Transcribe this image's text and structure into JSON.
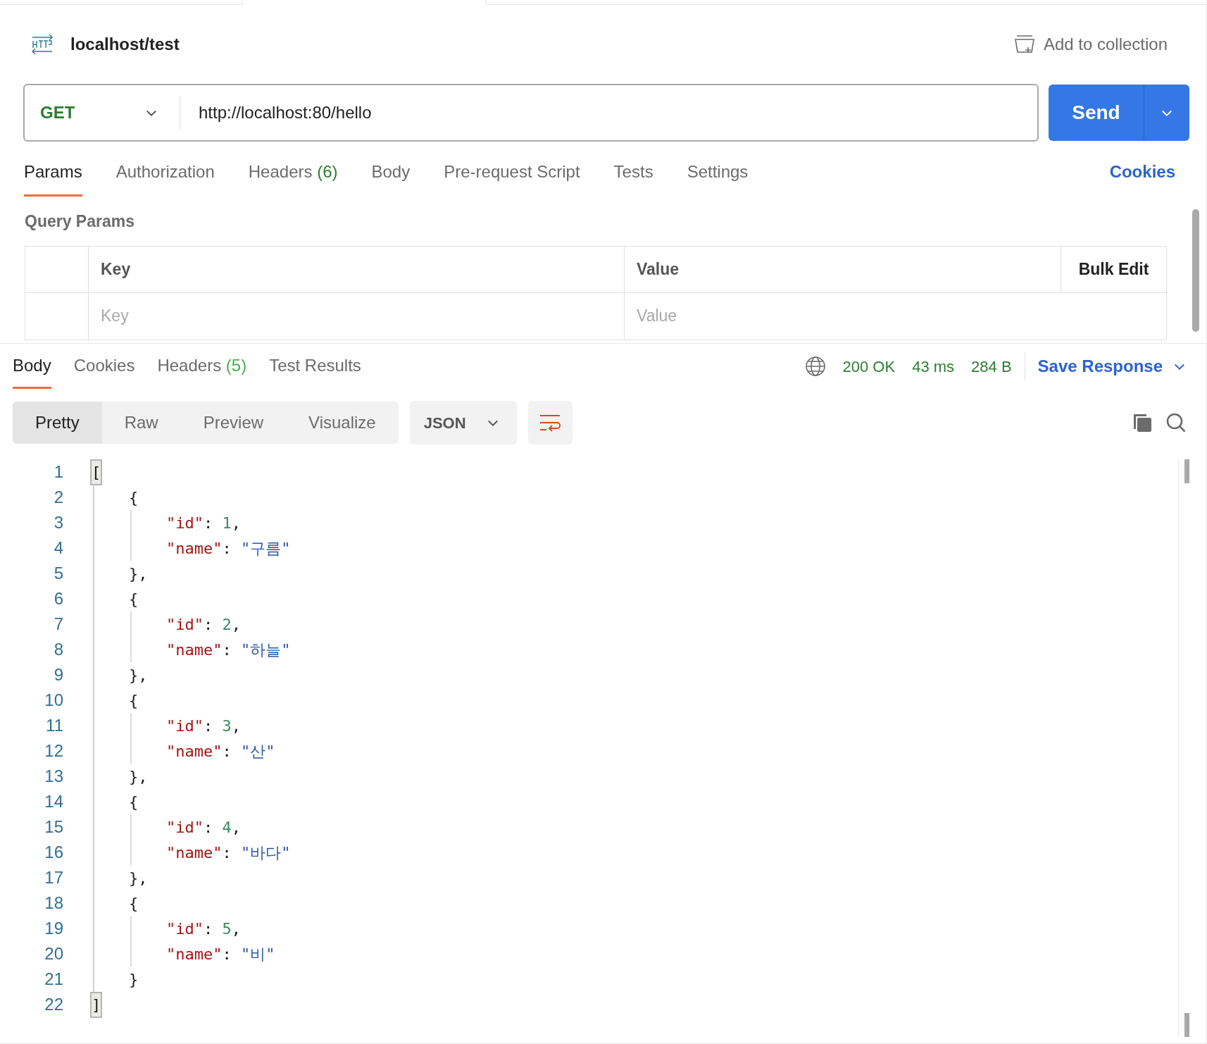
{
  "request": {
    "title": "localhost/test",
    "add_to_collection": "Add to collection",
    "method": "GET",
    "url": "http://localhost:80/hello",
    "send": "Send"
  },
  "request_tabs": [
    {
      "label": "Params",
      "selected": true
    },
    {
      "label": "Authorization",
      "selected": false
    },
    {
      "label": "Headers",
      "count": "(6)",
      "selected": false
    },
    {
      "label": "Body",
      "selected": false
    },
    {
      "label": "Pre-request Script",
      "selected": false
    },
    {
      "label": "Tests",
      "selected": false
    },
    {
      "label": "Settings",
      "selected": false
    }
  ],
  "cookies_link": "Cookies",
  "query_params": {
    "title": "Query Params",
    "columns": [
      "Key",
      "Value"
    ],
    "bulk_edit": "Bulk Edit",
    "row": {
      "key_placeholder": "Key",
      "value_placeholder": "Value"
    }
  },
  "response_tabs": [
    {
      "label": "Body",
      "selected": true
    },
    {
      "label": "Cookies",
      "selected": false
    },
    {
      "label": "Headers",
      "count": "(5)",
      "selected": false
    },
    {
      "label": "Test Results",
      "selected": false
    }
  ],
  "status": {
    "code": "200 OK",
    "time": "43 ms",
    "size": "284 B",
    "save": "Save Response"
  },
  "view_modes": [
    {
      "label": "Pretty",
      "selected": true
    },
    {
      "label": "Raw",
      "selected": false
    },
    {
      "label": "Preview",
      "selected": false
    },
    {
      "label": "Visualize",
      "selected": false
    }
  ],
  "format": "JSON",
  "code_lines": [
    {
      "number": "1",
      "highlighted": true,
      "tokens": [
        {
          "kind": "punct",
          "text": "["
        }
      ]
    },
    {
      "number": "2",
      "highlighted": false,
      "tokens": [
        {
          "kind": "punct",
          "text": "    {"
        }
      ]
    },
    {
      "number": "3",
      "highlighted": false,
      "tokens": [
        {
          "kind": "key",
          "text": "        \"id\""
        },
        {
          "kind": "punct",
          "text": ": "
        },
        {
          "kind": "number",
          "text": "1"
        },
        {
          "kind": "punct",
          "text": ","
        }
      ]
    },
    {
      "number": "4",
      "highlighted": false,
      "tokens": [
        {
          "kind": "key",
          "text": "        \"name\""
        },
        {
          "kind": "punct",
          "text": ": "
        },
        {
          "kind": "string",
          "text": "\"구름\""
        }
      ]
    },
    {
      "number": "5",
      "highlighted": false,
      "tokens": [
        {
          "kind": "punct",
          "text": "    },"
        }
      ]
    },
    {
      "number": "6",
      "highlighted": false,
      "tokens": [
        {
          "kind": "punct",
          "text": "    {"
        }
      ]
    },
    {
      "number": "7",
      "highlighted": false,
      "tokens": [
        {
          "kind": "key",
          "text": "        \"id\""
        },
        {
          "kind": "punct",
          "text": ": "
        },
        {
          "kind": "number",
          "text": "2"
        },
        {
          "kind": "punct",
          "text": ","
        }
      ]
    },
    {
      "number": "8",
      "highlighted": false,
      "tokens": [
        {
          "kind": "key",
          "text": "        \"name\""
        },
        {
          "kind": "punct",
          "text": ": "
        },
        {
          "kind": "string",
          "text": "\"하늘\""
        }
      ]
    },
    {
      "number": "9",
      "highlighted": false,
      "tokens": [
        {
          "kind": "punct",
          "text": "    },"
        }
      ]
    },
    {
      "number": "10",
      "highlighted": false,
      "tokens": [
        {
          "kind": "punct",
          "text": "    {"
        }
      ]
    },
    {
      "number": "11",
      "highlighted": false,
      "tokens": [
        {
          "kind": "key",
          "text": "        \"id\""
        },
        {
          "kind": "punct",
          "text": ": "
        },
        {
          "kind": "number",
          "text": "3"
        },
        {
          "kind": "punct",
          "text": ","
        }
      ]
    },
    {
      "number": "12",
      "highlighted": false,
      "tokens": [
        {
          "kind": "key",
          "text": "        \"name\""
        },
        {
          "kind": "punct",
          "text": ": "
        },
        {
          "kind": "string",
          "text": "\"산\""
        }
      ]
    },
    {
      "number": "13",
      "highlighted": false,
      "tokens": [
        {
          "kind": "punct",
          "text": "    },"
        }
      ]
    },
    {
      "number": "14",
      "highlighted": false,
      "tokens": [
        {
          "kind": "punct",
          "text": "    {"
        }
      ]
    },
    {
      "number": "15",
      "highlighted": false,
      "tokens": [
        {
          "kind": "key",
          "text": "        \"id\""
        },
        {
          "kind": "punct",
          "text": ": "
        },
        {
          "kind": "number",
          "text": "4"
        },
        {
          "kind": "punct",
          "text": ","
        }
      ]
    },
    {
      "number": "16",
      "highlighted": false,
      "tokens": [
        {
          "kind": "key",
          "text": "        \"name\""
        },
        {
          "kind": "punct",
          "text": ": "
        },
        {
          "kind": "string",
          "text": "\"바다\""
        }
      ]
    },
    {
      "number": "17",
      "highlighted": false,
      "tokens": [
        {
          "kind": "punct",
          "text": "    },"
        }
      ]
    },
    {
      "number": "18",
      "highlighted": false,
      "tokens": [
        {
          "kind": "punct",
          "text": "    {"
        }
      ]
    },
    {
      "number": "19",
      "highlighted": false,
      "tokens": [
        {
          "kind": "key",
          "text": "        \"id\""
        },
        {
          "kind": "punct",
          "text": ": "
        },
        {
          "kind": "number",
          "text": "5"
        },
        {
          "kind": "punct",
          "text": ","
        }
      ]
    },
    {
      "number": "20",
      "highlighted": false,
      "tokens": [
        {
          "kind": "key",
          "text": "        \"name\""
        },
        {
          "kind": "punct",
          "text": ": "
        },
        {
          "kind": "string",
          "text": "\"비\""
        }
      ]
    },
    {
      "number": "21",
      "highlighted": false,
      "tokens": [
        {
          "kind": "punct",
          "text": "    }"
        }
      ]
    },
    {
      "number": "22",
      "highlighted": true,
      "tokens": [
        {
          "kind": "punct",
          "text": "]"
        }
      ]
    }
  ]
}
